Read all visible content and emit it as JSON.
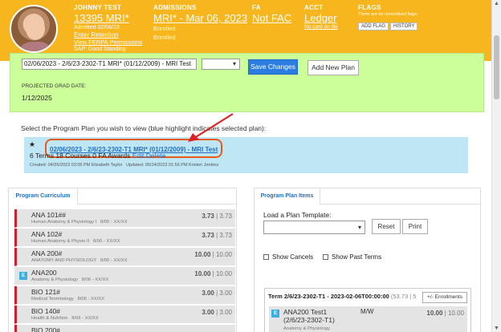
{
  "header": {
    "student_name": "JOHNNY TEST",
    "student_id": "13395 MRI*",
    "admitted": "Admitted 02/06/23",
    "enter_retention": "Enter Retention",
    "view_ferpa": "View FERPA Permissions",
    "sap": "SAP: Good Standing",
    "admissions_label": "ADMISSIONS",
    "admissions_value": "MRI* - Mar 06, 2023",
    "enrolled1": "Enrolled",
    "enrolled2": "Enrolled",
    "fa_label": "FA",
    "fa_value": "Not FAC",
    "acct_label": "ACCT",
    "acct_value": "Ledger",
    "no_card": "No card on file",
    "flags_label": "FLAGS",
    "flags_text": "There are no unresolved flags.",
    "add_flag": "ADD FLAG",
    "history": "HISTORY"
  },
  "plan_editor": {
    "plan_select_value": "02/06/2023 - 2/6/23-2302-T1 MRI* (01/12/2009) - MRI Test",
    "save_changes": "Save Changes",
    "add_new_plan": "Add New Plan",
    "projected_grad_label": "PROJECTED GRAD DATE:",
    "projected_grad_value": "1/12/2025"
  },
  "select_instruction": "Select the Program Plan you wish to view (blue highlight indicates selected plan):",
  "selected_plan": {
    "star": "★",
    "title": "02/06/2023 - 2/6/23-2302-T1 MRI* (01/12/2009) - MRI Test",
    "stats": "6 Terms 18 Courses 0 FA Awards",
    "edit": "Edit",
    "delete": "Delete",
    "created": "Created: 04/26/2023 03:05 PM Elizabeth Taylor",
    "updated": "Updated: 05/24/2023 01:56 PM Kristen Jenkins"
  },
  "curriculum": {
    "tab": "Program Curriculum",
    "courses": [
      {
        "code": "ANA 101##",
        "name": "Human Anatomy & Physiology I",
        "range": "8/06 - XX/XX",
        "hours": "3.73",
        "total": "3.73",
        "marker": "red"
      },
      {
        "code": "ANA 102#",
        "name": "Human Anatomy & Physio II",
        "range": "8/06 - XX/XX",
        "hours": "3.73",
        "total": "3.73",
        "marker": "red"
      },
      {
        "code": "ANA 200#",
        "name": "ANATOMY AND PHYSIOLOGY",
        "range": "8/06 - XX/XX",
        "hours": "10.00",
        "total": "10.00",
        "marker": "red"
      },
      {
        "code": "ANA200",
        "name": "Anatomy & Physiology",
        "range": "8/06 - XX/XX",
        "hours": "10.00",
        "total": "10.00",
        "marker": "E"
      },
      {
        "code": "BIO 121#",
        "name": "Medical Terminology",
        "range": "8/06 - XX/XX",
        "hours": "3.00",
        "total": "3.00",
        "marker": "red"
      },
      {
        "code": "BIO 140#",
        "name": "Health & Nutrition",
        "range": "8/06 - XX/XX",
        "hours": "3.00",
        "total": "3.00",
        "marker": "red"
      },
      {
        "code": "BIO 200#",
        "name": "",
        "range": "",
        "hours": "",
        "total": "",
        "marker": "red"
      }
    ]
  },
  "plan_items": {
    "tab": "Program Plan Items",
    "load_label": "Load a Plan Template:",
    "reset": "Reset",
    "print": "Print",
    "show_cancels": "Show Cancels",
    "show_past_terms": "Show Past Terms",
    "term_label": "Term 2/6/23-2302-T1 - 2023-02-06T00:00:00",
    "term_hours": "(53.73 | 5",
    "enrollments_btn": "+/- Enrollments",
    "item": {
      "code_line1": "ANA200 Test1",
      "code_line2": "(2/6/23-2302-T1)",
      "days": "M/W",
      "sub": "Anatomy & Physiology",
      "hours": "10.00",
      "total": "10.00"
    }
  }
}
